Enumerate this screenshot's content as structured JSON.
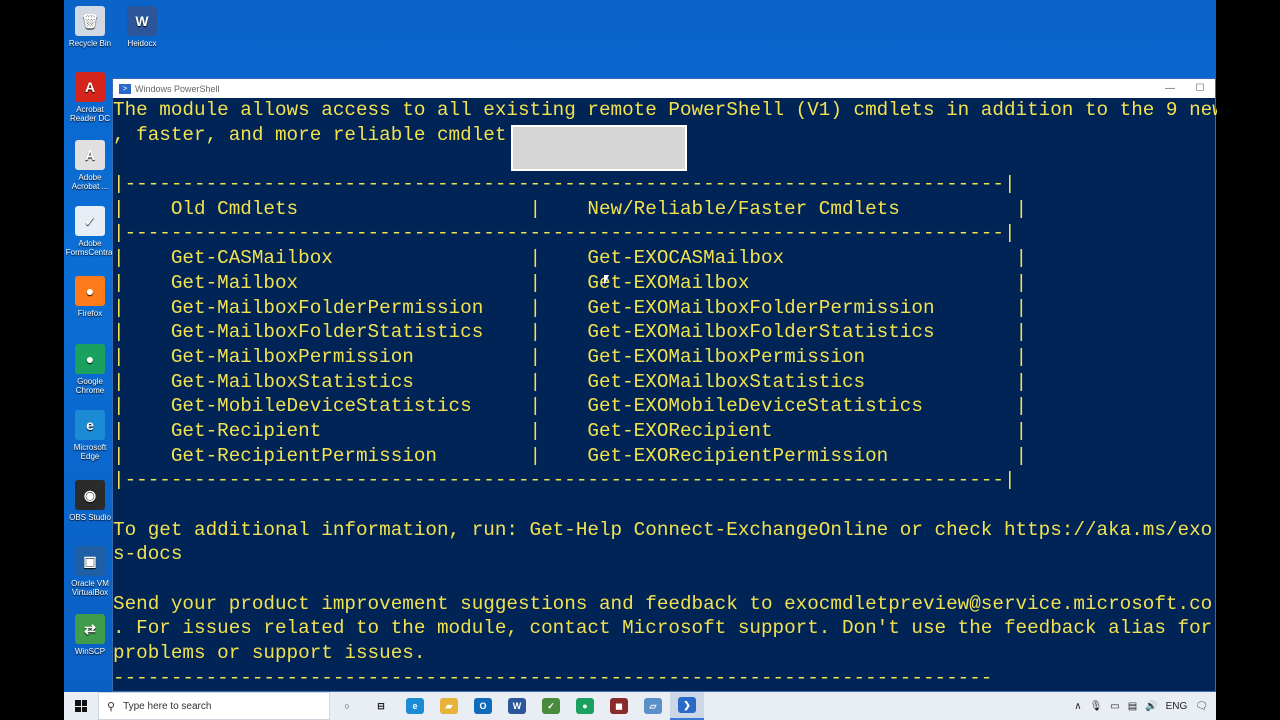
{
  "desktop": {
    "icons": [
      {
        "label": "Recycle Bin",
        "glyph": "🗑",
        "color": "#cfd8e3"
      },
      {
        "label": "Heidocx",
        "glyph": "W",
        "color": "#2b579a"
      },
      {
        "label": "Acrobat Reader DC",
        "glyph": "A",
        "color": "#d4241c"
      },
      {
        "label": "Adobe Acrobat ...",
        "glyph": "A",
        "color": "#e0e0e0"
      },
      {
        "label": "Adobe FormsCentral",
        "glyph": "✓",
        "color": "#e8eef5"
      },
      {
        "label": "Firefox",
        "glyph": "●",
        "color": "#ff7a1a"
      },
      {
        "label": "Google Chrome",
        "glyph": "●",
        "color": "#1aa15f"
      },
      {
        "label": "Microsoft Edge",
        "glyph": "e",
        "color": "#1c8bd6"
      },
      {
        "label": "OBS Studio",
        "glyph": "◉",
        "color": "#2b2b2b"
      },
      {
        "label": "Oracle VM VirtualBox",
        "glyph": "▣",
        "color": "#1f5fa6"
      },
      {
        "label": "WinSCP",
        "glyph": "⇄",
        "color": "#3f9c4a"
      }
    ]
  },
  "window": {
    "title": "Windows PowerShell",
    "minimize": "—",
    "maximize": "☐"
  },
  "console": {
    "lines": [
      "The module allows access to all existing remote PowerShell (V1) cmdlets in addition to the 9 new",
      ", faster, and more reliable cmdlet",
      "",
      "|----------------------------------------------------------------------------|",
      "|    Old Cmdlets                    |    New/Reliable/Faster Cmdlets          |",
      "|----------------------------------------------------------------------------|",
      "|    Get-CASMailbox                 |    Get-EXOCASMailbox                    |",
      "|    Get-Mailbox                    |    Get-EXOMailbox                       |",
      "|    Get-MailboxFolderPermission    |    Get-EXOMailboxFolderPermission       |",
      "|    Get-MailboxFolderStatistics    |    Get-EXOMailboxFolderStatistics       |",
      "|    Get-MailboxPermission          |    Get-EXOMailboxPermission             |",
      "|    Get-MailboxStatistics          |    Get-EXOMailboxStatistics             |",
      "|    Get-MobileDeviceStatistics     |    Get-EXOMobileDeviceStatistics        |",
      "|    Get-Recipient                  |    Get-EXORecipient                     |",
      "|    Get-RecipientPermission        |    Get-EXORecipientPermission           |",
      "|----------------------------------------------------------------------------|",
      "",
      "To get additional information, run: Get-Help Connect-ExchangeOnline or check https://aka.ms/exo",
      "s-docs",
      "",
      "Send your product improvement suggestions and feedback to exocmdletpreview@service.microsoft.co",
      ". For issues related to the module, contact Microsoft support. Don't use the feedback alias for",
      "problems or support issues.",
      "----------------------------------------------------------------------------"
    ],
    "text_color": "#f2e24f",
    "background": "#012456"
  },
  "taskbar": {
    "search_placeholder": "Type here to search",
    "apps": [
      {
        "name": "task-view",
        "glyph": "○",
        "color": "transparent",
        "text": "#222"
      },
      {
        "name": "widgets",
        "glyph": "⊟",
        "color": "transparent",
        "text": "#222"
      },
      {
        "name": "edge",
        "glyph": "e",
        "color": "#1c8bd6",
        "text": "#fff"
      },
      {
        "name": "file-explorer",
        "glyph": "▰",
        "color": "#e8b33a",
        "text": "#fff"
      },
      {
        "name": "outlook",
        "glyph": "O",
        "color": "#0f6cbd",
        "text": "#fff"
      },
      {
        "name": "word",
        "glyph": "W",
        "color": "#2b579a",
        "text": "#fff"
      },
      {
        "name": "excel-like",
        "glyph": "✓",
        "color": "#4a8a3c",
        "text": "#fff"
      },
      {
        "name": "chrome",
        "glyph": "●",
        "color": "#1aa15f",
        "text": "#fff"
      },
      {
        "name": "screen-recorder",
        "glyph": "◼",
        "color": "#8a2b2b",
        "text": "#fff"
      },
      {
        "name": "terminal",
        "glyph": "▱",
        "color": "#5a8fc8",
        "text": "#fff"
      },
      {
        "name": "powershell",
        "glyph": "❯",
        "color": "#2a6ac6",
        "text": "#fff"
      }
    ],
    "tray": {
      "chevron": "∧",
      "language": "ENG",
      "notification": "🗨"
    }
  }
}
